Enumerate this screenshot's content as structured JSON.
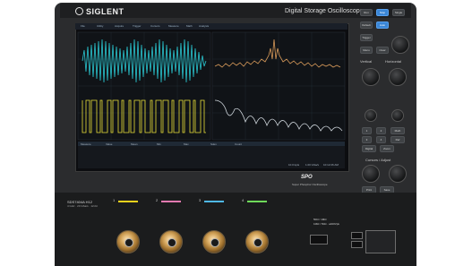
{
  "brand": {
    "name": "SIGLENT",
    "tagline": "Digital Storage Oscilloscope"
  },
  "screen": {
    "menu": [
      "File",
      "Utility",
      "Acquire",
      "Trigger",
      "Cursors",
      "Measure",
      "Math",
      "Analysis"
    ],
    "panel": {
      "headers": [
        "Measure",
        "Value",
        "Mean",
        "Min",
        "Max",
        "Sdev",
        "Count"
      ]
    },
    "status": [
      "10.0 kpts",
      "1.00 GSa/s",
      "10:12:26 AM"
    ]
  },
  "right_panel": {
    "buttons_top": [
      "Run",
      "Stop",
      "Single",
      "Default",
      "Auto",
      "Trigger"
    ],
    "labels": {
      "vertical": "Vertical",
      "horizontal": "Horizontal",
      "cursors": "Cursors / Adjust"
    },
    "buttons_mid": [
      "1",
      "2",
      "3",
      "4",
      "Math",
      "Ref",
      "Digital",
      "Zoom"
    ],
    "buttons_bottom": [
      "Menu",
      "Clear",
      "Print",
      "Save"
    ]
  },
  "sds": {
    "logo": "SPO",
    "caption": "Super Phosphor Oscilloscope"
  },
  "bottom": {
    "model": "SDS7404A H12",
    "spec": "4 GHz · 20 GSa/s · 12-bit",
    "channels": [
      {
        "num": "1",
        "color": "#f3d21c"
      },
      {
        "num": "2",
        "color": "#e27ab0"
      },
      {
        "num": "3",
        "color": "#4fb8e8"
      },
      {
        "num": "4",
        "color": "#6fda5a"
      }
    ],
    "warning": "50Ω / 1MΩ",
    "warning_sub": "1MΩ / 50Ω · ≤400Vpk"
  },
  "colors": {
    "ch1": "#f3d21c",
    "ch2": "#e27ab0",
    "ch3": "#4fb8e8",
    "ch4": "#6fda5a"
  },
  "icons": [
    "brand-logo-icon",
    "channel-knob-icon",
    "bnc-connector-icon",
    "usb-port-icon"
  ]
}
